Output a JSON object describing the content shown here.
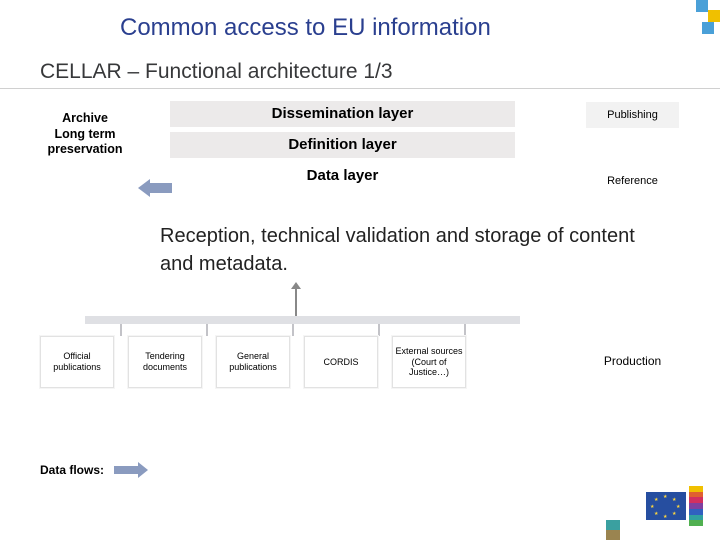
{
  "title": "Common access to EU information",
  "subtitle": "CELLAR – Functional architecture 1/3",
  "left_box": {
    "line1": "Archive",
    "line2": "Long term",
    "line3": "preservation"
  },
  "layers": {
    "l1": "Dissemination layer",
    "l2": "Definition layer",
    "l3": "Data layer"
  },
  "right": {
    "r1": "Publishing",
    "r2": "Reference"
  },
  "caption": "Reception, technical validation and storage of content and metadata.",
  "sources": {
    "s1": "Official publications",
    "s2": "Tendering documents",
    "s3": "General publications",
    "s4": "CORDIS",
    "s5": "External sources (Court of Justice…)"
  },
  "production": "Production",
  "data_flows_label": "Data flows:"
}
